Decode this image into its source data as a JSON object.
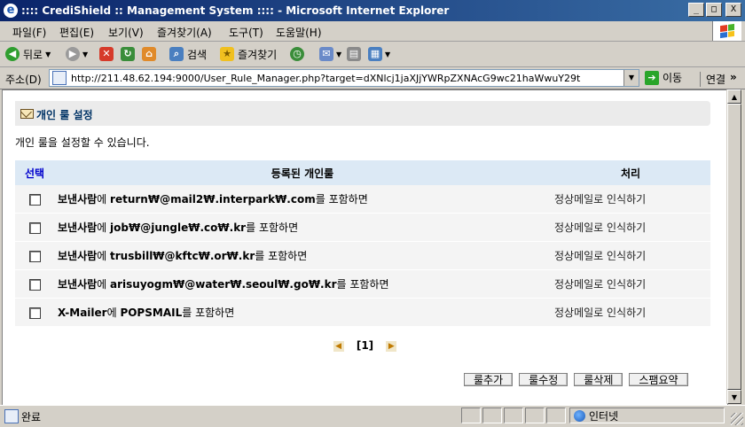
{
  "window": {
    "title": ":::: CrediShield :: Management System :::: - Microsoft Internet Explorer",
    "minimize": "_",
    "maximize": "□",
    "close": "X"
  },
  "menu": [
    "파일(F)",
    "편집(E)",
    "보기(V)",
    "즐겨찾기(A)",
    "도구(T)",
    "도움말(H)"
  ],
  "toolbar": {
    "back_label": "뒤로",
    "search_label": "검색",
    "favorites_label": "즐겨찾기"
  },
  "address": {
    "label": "주소(D)",
    "url": "http://211.48.62.194:9000/User_Rule_Manager.php?target=dXNlcj1jaXJjYWRpZXNAcG9wc21haWwuY29t",
    "go_label": "이동",
    "links_label": "연결",
    "links_chevron": "»"
  },
  "page": {
    "section_title": "개인 룰 설정",
    "description": "개인 룰을 설정할 수 있습니다.",
    "columns": {
      "select": "선택",
      "rule": "등록된 개인룰",
      "action": "처리"
    },
    "rows": [
      {
        "field": "보낸사람",
        "particle": "에 ",
        "value": "return₩@mail2₩.interpark₩.com",
        "suffix": "를 포함하면",
        "action": "정상메일로 인식하기"
      },
      {
        "field": "보낸사람",
        "particle": "에 ",
        "value": "job₩@jungle₩.co₩.kr",
        "suffix": "를 포함하면",
        "action": "정상메일로 인식하기"
      },
      {
        "field": "보낸사람",
        "particle": "에 ",
        "value": "trusbill₩@kftc₩.or₩.kr",
        "suffix": "를 포함하면",
        "action": "정상메일로 인식하기"
      },
      {
        "field": "보낸사람",
        "particle": "에 ",
        "value": "arisuyogm₩@water₩.seoul₩.go₩.kr",
        "suffix": "를 포함하면",
        "action": "정상메일로 인식하기"
      },
      {
        "field": "X-Mailer",
        "particle": "에 ",
        "value": "POPSMAIL",
        "suffix": "를 포함하면",
        "action": "정상메일로 인식하기"
      }
    ],
    "pagination": {
      "current": "[1]"
    },
    "buttons": {
      "add": "룰추가",
      "edit": "룰수정",
      "delete": "룰삭제",
      "spam_summary": "스팸요약"
    }
  },
  "status": {
    "text": "완료",
    "zone": "인터넷"
  }
}
